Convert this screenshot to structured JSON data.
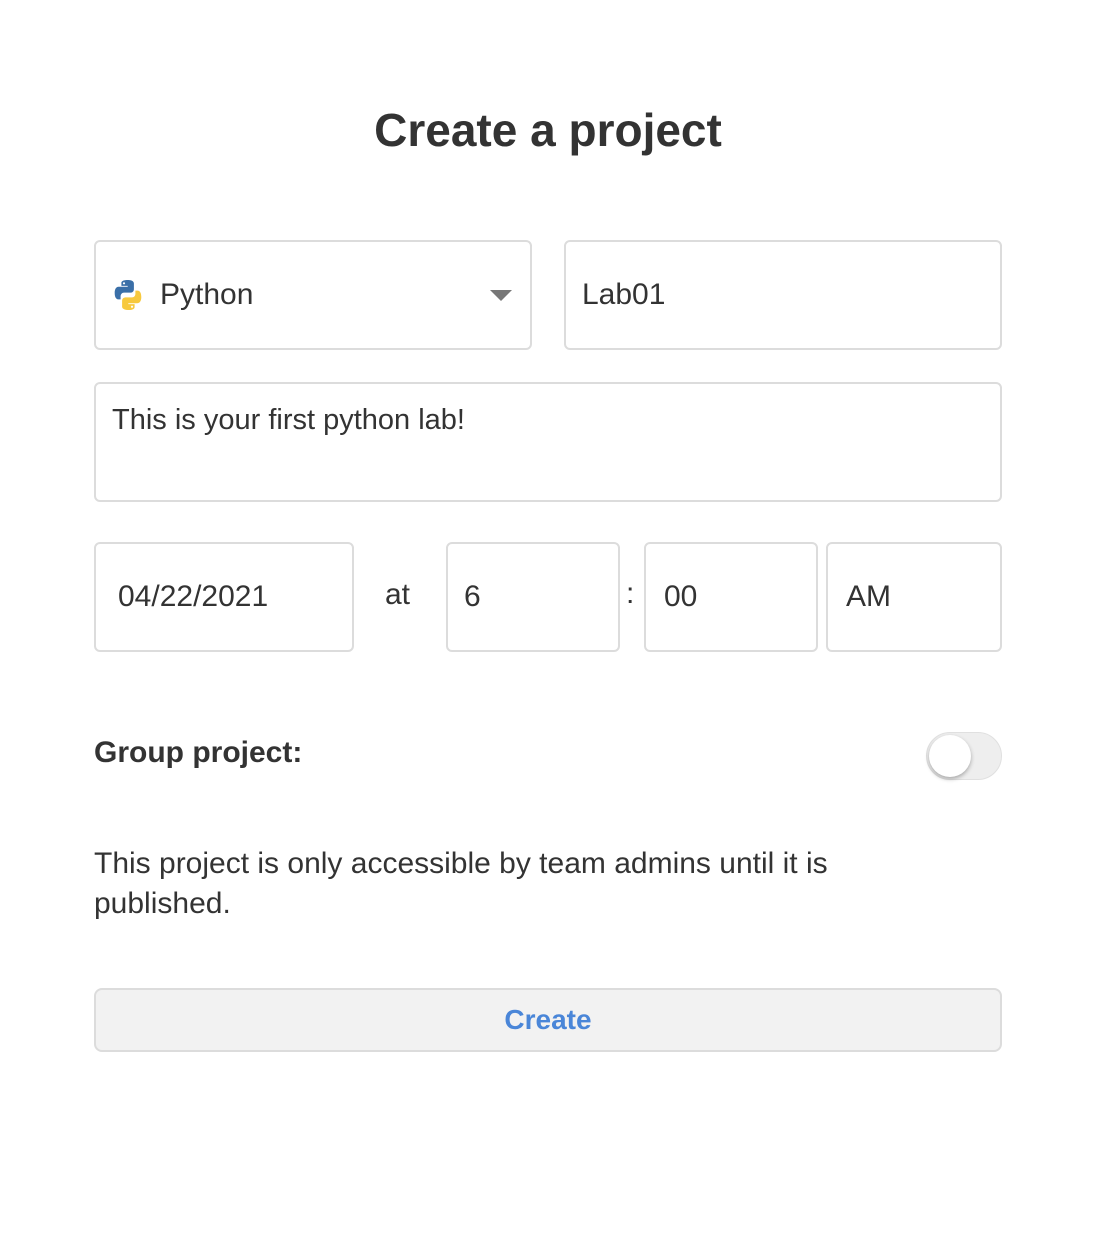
{
  "modal": {
    "title": "Create a project"
  },
  "form": {
    "language": {
      "selected": "Python",
      "icon": "python-logo-icon"
    },
    "project_name": {
      "value": "Lab01"
    },
    "description": {
      "value": "This is your first python lab!"
    },
    "schedule": {
      "date": "04/22/2021",
      "at_label": "at",
      "hour": "6",
      "separator": ":",
      "minute": "00",
      "period": "AM"
    },
    "group_project": {
      "label": "Group project:",
      "enabled": false
    },
    "info_text": "This project is only accessible by team admins until it is published.",
    "create_label": "Create"
  },
  "colors": {
    "accent": "#4a86d8",
    "border": "#dcdcdc",
    "text": "#333333",
    "button_bg": "#f2f2f2"
  }
}
